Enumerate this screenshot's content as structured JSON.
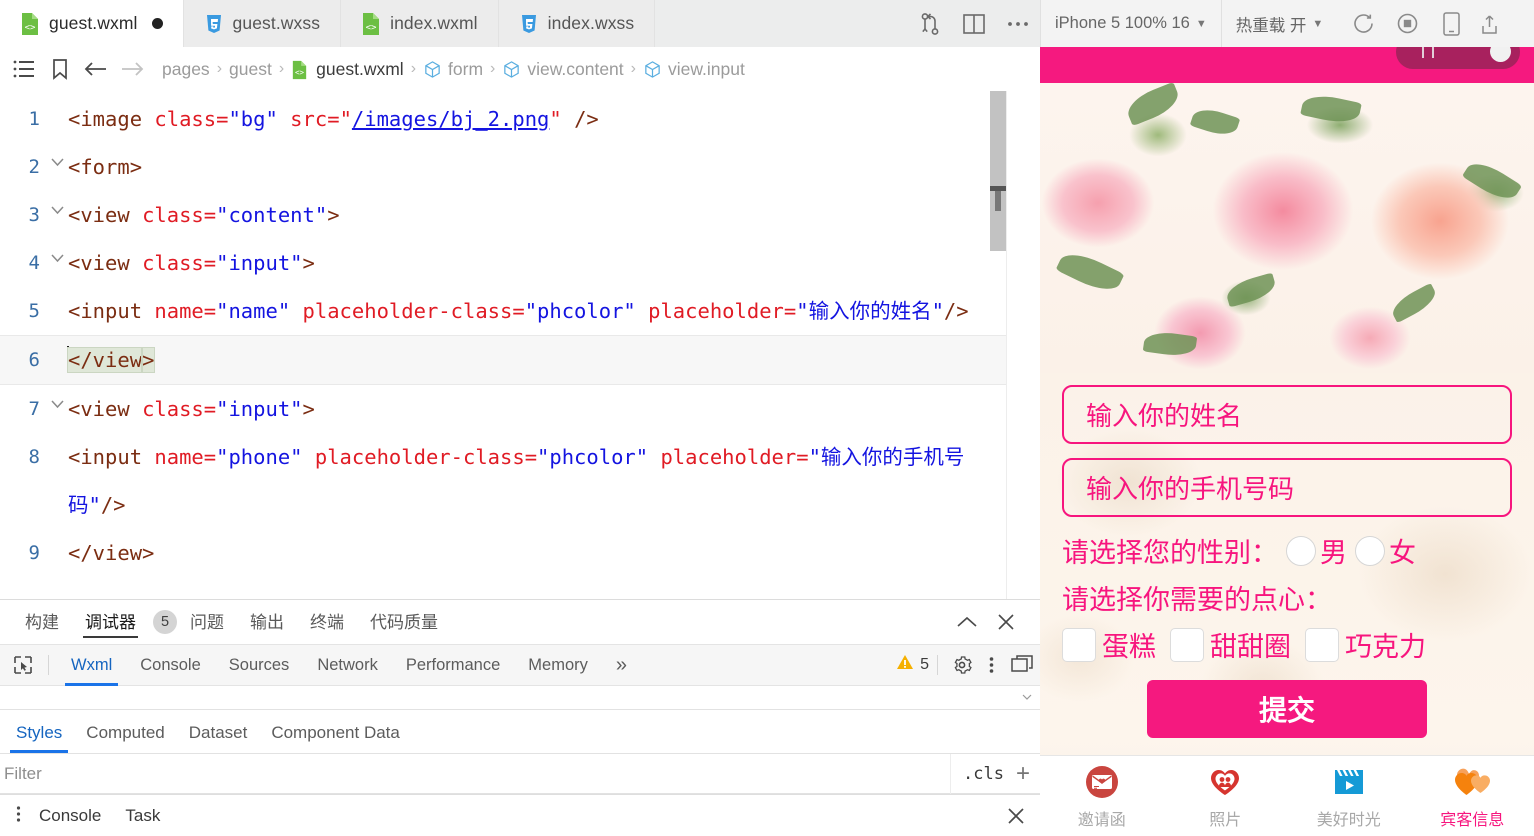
{
  "tabs": [
    {
      "label": "guest.wxml",
      "icon": "wxml-file-icon",
      "active": true,
      "dirty": true
    },
    {
      "label": "guest.wxss",
      "icon": "wxss-file-icon",
      "active": false,
      "dirty": false
    },
    {
      "label": "index.wxml",
      "icon": "wxml-file-icon",
      "active": false,
      "dirty": false
    },
    {
      "label": "index.wxss",
      "icon": "wxss-file-icon",
      "active": false,
      "dirty": false
    }
  ],
  "toolbar": {
    "compare_icon": "compare-branches-icon",
    "split_icon": "split-editor-icon",
    "more_icon": "more-actions-icon",
    "device": "iPhone 5 100% 16",
    "hotreload": "热重载 开",
    "refresh_icon": "refresh-icon",
    "stop_icon": "stop-record-icon",
    "device_icon": "mobile-preview-icon",
    "clear_icon": "clear-cache-icon"
  },
  "breadcrumb": {
    "menu_icon": "outline-icon",
    "bookmark_icon": "bookmark-icon",
    "back_icon": "back-arrow-icon",
    "forward_icon": "forward-arrow-icon",
    "items": [
      {
        "label": "pages",
        "icon": null
      },
      {
        "label": "guest",
        "icon": null
      },
      {
        "label": "guest.wxml",
        "icon": "wxml-file-icon"
      },
      {
        "label": "form",
        "icon": "cube-icon"
      },
      {
        "label": "view.content",
        "icon": "cube-icon"
      },
      {
        "label": "view.input",
        "icon": "cube-icon"
      }
    ]
  },
  "editor": {
    "lines": [
      {
        "num": "1",
        "fold": ""
      },
      {
        "num": "2",
        "fold": "v"
      },
      {
        "num": "3",
        "fold": "v"
      },
      {
        "num": "4",
        "fold": "v"
      },
      {
        "num": "5",
        "fold": ""
      },
      {
        "num": "6",
        "fold": ""
      },
      {
        "num": "7",
        "fold": "v"
      },
      {
        "num": "8",
        "fold": ""
      },
      {
        "num": "9",
        "fold": ""
      }
    ],
    "code": {
      "l1_tag_open": "<image ",
      "l1_attr_class": "class=",
      "l1_val_bg": "\"bg\"",
      "l1_attr_src": " src=",
      "l1_q1": "\"",
      "l1_link": "/images/bj_2.png",
      "l1_q2": "\"",
      "l1_close": " />",
      "l2": "<form>",
      "l3_open": "<view ",
      "l3_attr": "class=",
      "l3_val": "\"content\"",
      "l3_close": ">",
      "l4_open": "<view ",
      "l4_attr": "class=",
      "l4_val": "\"input\"",
      "l4_close": ">",
      "l5_open": "<input ",
      "l5_a1": "name=",
      "l5_v1": "\"name\"",
      "l5_a2": " placeholder-class=",
      "l5_v2": "\"phcolor\"",
      "l5_a3": " placeholder=",
      "l5_v3": "\"输入你的姓名\"",
      "l5_close": "/>",
      "l6_a": "</view",
      "l6_b": ">",
      "l7_open": "<view ",
      "l7_attr": "class=",
      "l7_val": "\"input\"",
      "l7_close": ">",
      "l8_open": "<input ",
      "l8_a1": "name=",
      "l8_v1": "\"phone\"",
      "l8_a2": " placeholder-class=",
      "l8_v2": "\"phcolor\"",
      "l8_a3": " placeholder=",
      "l8_v3": "\"输入你的手机号码\"",
      "l8_close": "/>",
      "l9": "</view>"
    }
  },
  "devtools": {
    "panels": [
      {
        "label": "构建",
        "active": false,
        "count": null
      },
      {
        "label": "调试器",
        "active": true,
        "count": "5"
      },
      {
        "label": "问题",
        "active": false,
        "count": null
      },
      {
        "label": "输出",
        "active": false,
        "count": null
      },
      {
        "label": "终端",
        "active": false,
        "count": null
      },
      {
        "label": "代码质量",
        "active": false,
        "count": null
      }
    ],
    "collapse_icon": "collapse-panel-icon",
    "close_icon": "close-panel-icon",
    "inspect_icon": "inspect-element-icon",
    "chrome_tabs": [
      {
        "label": "Wxml",
        "active": true
      },
      {
        "label": "Console",
        "active": false
      },
      {
        "label": "Sources",
        "active": false
      },
      {
        "label": "Network",
        "active": false
      },
      {
        "label": "Performance",
        "active": false
      },
      {
        "label": "Memory",
        "active": false
      }
    ],
    "overflow_label": "»",
    "warning_icon": "warning-icon",
    "warning_count": "5",
    "settings_icon": "gear-icon",
    "kebab_icon": "more-options-icon",
    "dock_icon": "dock-side-icon",
    "style_tabs": [
      {
        "label": "Styles",
        "active": true
      },
      {
        "label": "Computed",
        "active": false
      },
      {
        "label": "Dataset",
        "active": false
      },
      {
        "label": "Component Data",
        "active": false
      }
    ],
    "filter_placeholder": "Filter",
    "filter_value": "",
    "cls_label": ".cls",
    "add_rule_icon": "add-rule-icon",
    "drawer_kebab_icon": "drawer-menu-icon",
    "drawer_tabs": [
      {
        "label": "Console",
        "active": false
      },
      {
        "label": "Task",
        "active": false
      }
    ],
    "drawer_close_icon": "close-drawer-icon"
  },
  "simulator": {
    "colors": {
      "pink": "#f5197f",
      "pink_text": "#f7157e",
      "beige": "#fbf2e8"
    },
    "form": {
      "name_placeholder": "输入你的姓名",
      "phone_placeholder": "输入你的手机号码",
      "gender_label": "请选择您的性别：",
      "gender_options": [
        "男",
        "女"
      ],
      "dessert_label": "请选择你需要的点心：",
      "dessert_options": [
        "蛋糕",
        "甜甜圈",
        "巧克力"
      ],
      "submit_label": "提交"
    },
    "tabbar": [
      {
        "label": "邀请函",
        "icon": "envelope-icon",
        "active": false
      },
      {
        "label": "照片",
        "icon": "heart-photo-icon",
        "active": false
      },
      {
        "label": "美好时光",
        "icon": "video-clapper-icon",
        "active": false
      },
      {
        "label": "宾客信息",
        "icon": "two-hearts-icon",
        "active": true
      }
    ]
  }
}
